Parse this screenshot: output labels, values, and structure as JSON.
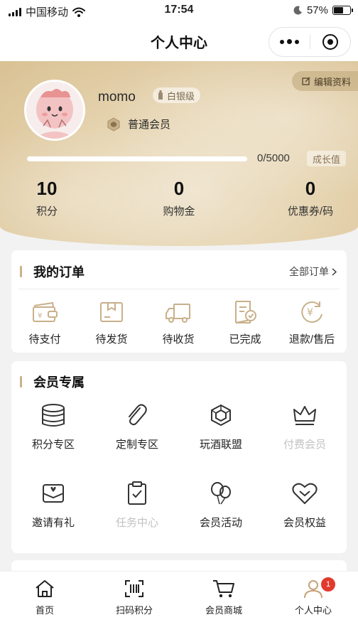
{
  "status_bar": {
    "carrier": "中国移动",
    "time": "17:54",
    "battery": "57%",
    "battery_level": 0.57
  },
  "nav": {
    "title": "个人中心"
  },
  "profile": {
    "edit_label": "编辑资料",
    "username": "momo",
    "level": "白银级",
    "member_type": "普通会员",
    "growth_current": "0",
    "growth_target": "/5000",
    "growth_progress": 0,
    "growth_label": "成长值",
    "stats": [
      {
        "value": "10",
        "label": "积分"
      },
      {
        "value": "0",
        "label": "购物金"
      },
      {
        "value": "0",
        "label": "优惠券/码"
      }
    ]
  },
  "orders": {
    "title": "我的订单",
    "all_label": "全部订单",
    "items": [
      {
        "label": "待支付",
        "icon": "wallet-icon"
      },
      {
        "label": "待发货",
        "icon": "package-icon"
      },
      {
        "label": "待收货",
        "icon": "truck-icon"
      },
      {
        "label": "已完成",
        "icon": "document-check-icon"
      },
      {
        "label": "退款/售后",
        "icon": "refund-icon"
      }
    ]
  },
  "member": {
    "title": "会员专属",
    "items": [
      {
        "label": "积分专区",
        "icon": "coins-icon",
        "enabled": true
      },
      {
        "label": "定制专区",
        "icon": "paperclip-icon",
        "enabled": true
      },
      {
        "label": "玩酒联盟",
        "icon": "cube-icon",
        "enabled": true
      },
      {
        "label": "付费会员",
        "icon": "crown-icon",
        "enabled": false
      },
      {
        "label": "邀请有礼",
        "icon": "gift-envelope-icon",
        "enabled": true
      },
      {
        "label": "任务中心",
        "icon": "clipboard-check-icon",
        "enabled": false
      },
      {
        "label": "会员活动",
        "icon": "balloons-icon",
        "enabled": true
      },
      {
        "label": "会员权益",
        "icon": "heart-shield-icon",
        "enabled": true
      }
    ]
  },
  "tabbar": {
    "items": [
      {
        "label": "首页",
        "icon": "home-icon"
      },
      {
        "label": "扫码积分",
        "icon": "scan-icon"
      },
      {
        "label": "会员商城",
        "icon": "cart-icon"
      },
      {
        "label": "个人中心",
        "icon": "user-icon",
        "badge": "1"
      }
    ]
  },
  "colors": {
    "accent_gold": "#b9974f",
    "badge_red": "#e23a2e"
  }
}
